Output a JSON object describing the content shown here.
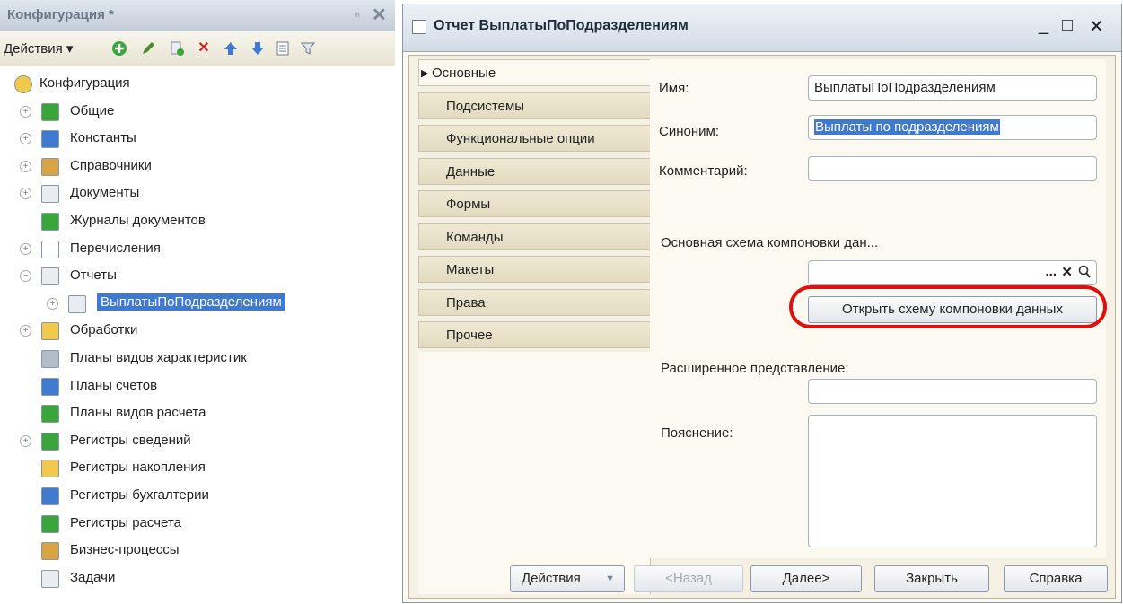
{
  "config_panel": {
    "title": "Конфигурация *",
    "pin": "ₕ",
    "close": "✕",
    "toolbar": {
      "actions_label": "Действия ▾"
    },
    "tree": [
      {
        "label": "Конфигурация",
        "icon": "config-icon",
        "expand": "",
        "level": 0
      },
      {
        "label": "Общие",
        "icon": "common-icon",
        "expand": "+",
        "level": 1
      },
      {
        "label": "Константы",
        "icon": "constants-icon",
        "expand": "+",
        "level": 1
      },
      {
        "label": "Справочники",
        "icon": "catalogs-icon",
        "expand": "+",
        "level": 1
      },
      {
        "label": "Документы",
        "icon": "documents-icon",
        "expand": "+",
        "level": 1
      },
      {
        "label": "Журналы документов",
        "icon": "journals-icon",
        "expand": "",
        "level": 1
      },
      {
        "label": "Перечисления",
        "icon": "enums-icon",
        "expand": "+",
        "level": 1
      },
      {
        "label": "Отчеты",
        "icon": "reports-icon",
        "expand": "−",
        "level": 1
      },
      {
        "label": "ВыплатыПоПодразделениям",
        "icon": "report-icon",
        "expand": "+",
        "level": 2,
        "selected": true
      },
      {
        "label": "Обработки",
        "icon": "processing-icon",
        "expand": "+",
        "level": 1
      },
      {
        "label": "Планы видов характеристик",
        "icon": "chart-char-icon",
        "expand": "",
        "level": 1
      },
      {
        "label": "Планы счетов",
        "icon": "accounts-icon",
        "expand": "",
        "level": 1
      },
      {
        "label": "Планы видов расчета",
        "icon": "calc-types-icon",
        "expand": "",
        "level": 1
      },
      {
        "label": "Регистры сведений",
        "icon": "info-reg-icon",
        "expand": "+",
        "level": 1
      },
      {
        "label": "Регистры накопления",
        "icon": "accum-reg-icon",
        "expand": "",
        "level": 1
      },
      {
        "label": "Регистры бухгалтерии",
        "icon": "acc-reg-icon",
        "expand": "",
        "level": 1
      },
      {
        "label": "Регистры расчета",
        "icon": "calc-reg-icon",
        "expand": "",
        "level": 1
      },
      {
        "label": "Бизнес-процессы",
        "icon": "bp-icon",
        "expand": "",
        "level": 1
      },
      {
        "label": "Задачи",
        "icon": "tasks-icon",
        "expand": "",
        "level": 1
      }
    ]
  },
  "report_window": {
    "title": "Отчет ВыплатыПоПодразделениям",
    "controls": {
      "minimize": "_",
      "maximize": "□",
      "close": "✕"
    },
    "tabs": [
      {
        "label": "Основные",
        "active": true
      },
      {
        "label": "Подсистемы"
      },
      {
        "label": "Функциональные опции"
      },
      {
        "label": "Данные"
      },
      {
        "label": "Формы"
      },
      {
        "label": "Команды"
      },
      {
        "label": "Макеты"
      },
      {
        "label": "Права"
      },
      {
        "label": "Прочее"
      }
    ],
    "fields": {
      "name_label": "Имя:",
      "name_value": "ВыплатыПоПодразделениям",
      "synonym_label": "Синоним:",
      "synonym_value": "Выплаты по подразделениям",
      "comment_label": "Комментарий:",
      "comment_value": "",
      "schema_label": "Основная схема компоновки дан...",
      "schema_value": "",
      "schema_ellipsis": "...",
      "schema_clear": "✕",
      "open_schema_button": "Открыть схему компоновки данных",
      "extended_label": "Расширенное представление:",
      "extended_value": "",
      "explanation_label": "Пояснение:",
      "explanation_value": ""
    },
    "buttons": {
      "actions": "Действия",
      "back": "<Назад",
      "next": "Далее>",
      "close": "Закрыть",
      "help": "Справка"
    },
    "highlight_color": "#e01010"
  }
}
